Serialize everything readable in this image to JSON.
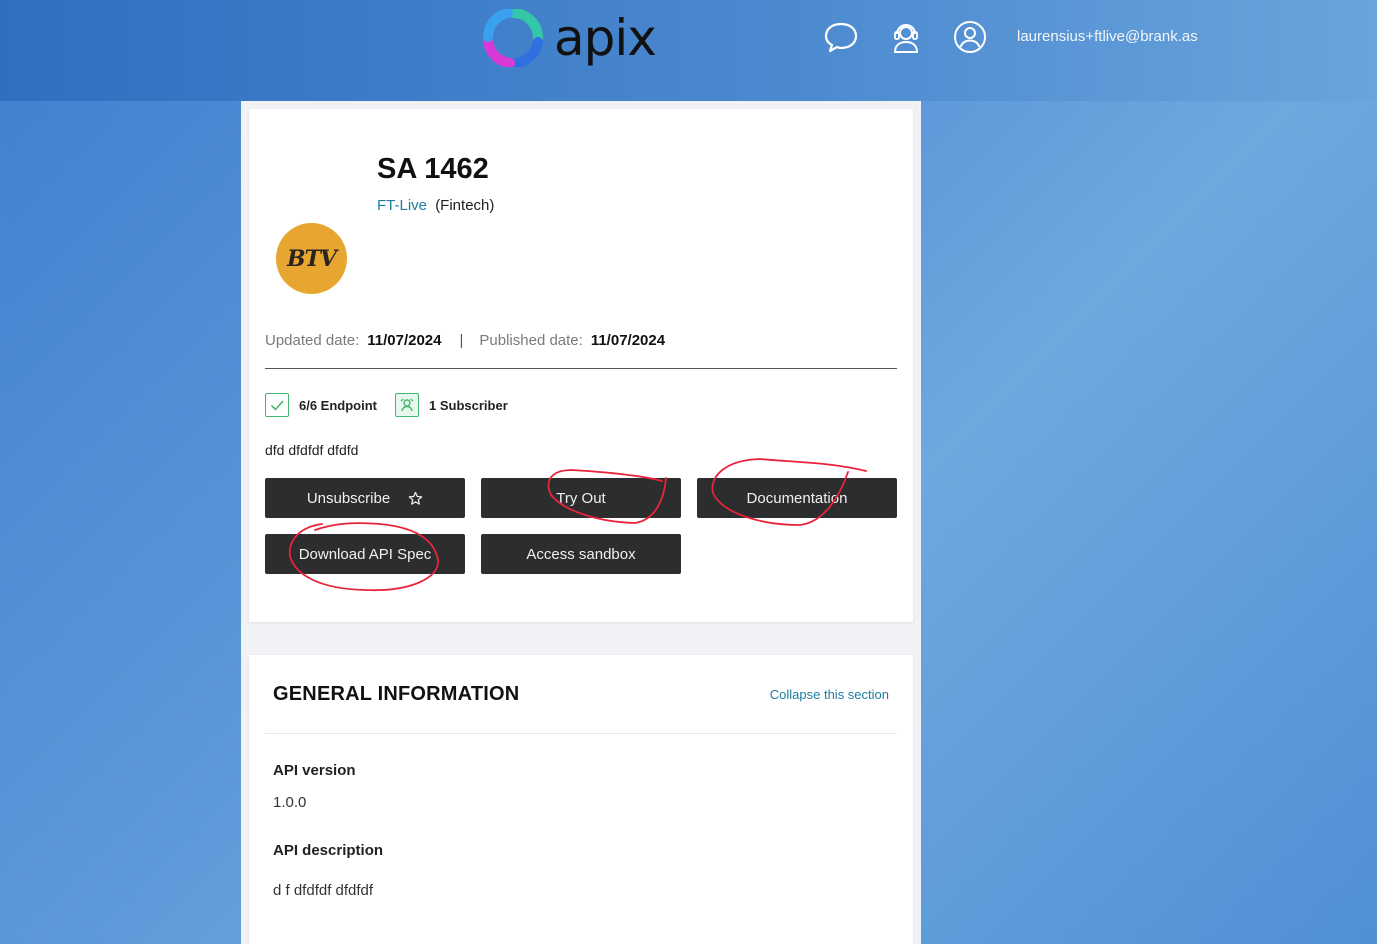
{
  "header": {
    "brand": "apix",
    "user_email": "laurensius+ftlive@brank.as",
    "icons": [
      "chat-icon",
      "support-agent-icon",
      "account-icon"
    ]
  },
  "api": {
    "title": "SA 1462",
    "provider": "FT-Live",
    "category": "(Fintech)",
    "logo_text": "BTV",
    "updated_label": "Updated date:",
    "updated_value": "11/07/2024",
    "separator": "|",
    "published_label": "Published date:",
    "published_value": "11/07/2024",
    "endpoint_stat": "6/6 Endpoint",
    "subscriber_stat": "1 Subscriber",
    "description": "dfd dfdfdf dfdfd"
  },
  "actions": {
    "unsubscribe": "Unsubscribe",
    "try_out": "Try Out",
    "documentation": "Documentation",
    "download_spec": "Download API Spec",
    "access_sandbox": "Access sandbox"
  },
  "general_info": {
    "title": "GENERAL INFORMATION",
    "collapse": "Collapse this section",
    "version_label": "API version",
    "version_value": "1.0.0",
    "description_label": "API description",
    "description_value": "d f dfdfdf dfdfdf"
  },
  "colors": {
    "accent_link": "#1f7ca0",
    "button_bg": "#2b2d2e",
    "success_green": "#44b86a",
    "annotation_red": "#e8243a",
    "logo_gold": "#e7a630"
  }
}
